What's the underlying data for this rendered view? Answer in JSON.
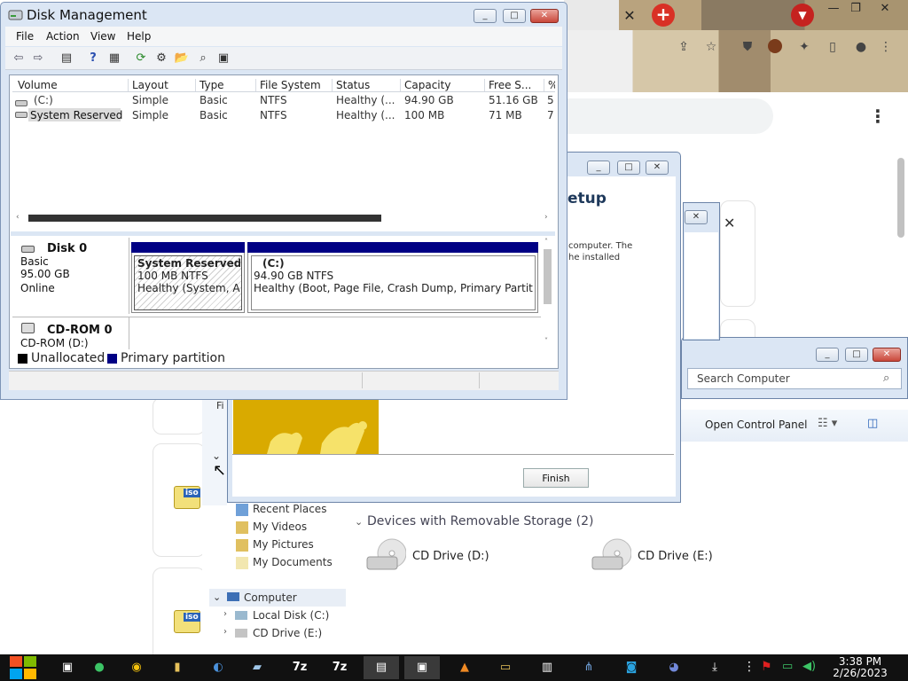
{
  "disk_management": {
    "title": "Disk Management",
    "menu": [
      "File",
      "Action",
      "View",
      "Help"
    ],
    "columns": [
      "Volume",
      "Layout",
      "Type",
      "File System",
      "Status",
      "Capacity",
      "Free S...",
      "%"
    ],
    "volumes": [
      {
        "volume": "(C:)",
        "layout": "Simple",
        "type": "Basic",
        "fs": "NTFS",
        "status": "Healthy (...",
        "capacity": "94.90 GB",
        "free": "51.16 GB",
        "pct": "5"
      },
      {
        "volume": "System Reserved",
        "layout": "Simple",
        "type": "Basic",
        "fs": "NTFS",
        "status": "Healthy (...",
        "capacity": "100 MB",
        "free": "71 MB",
        "pct": "7"
      }
    ],
    "disk0": {
      "name": "Disk 0",
      "type": "Basic",
      "size": "95.00 GB",
      "state": "Online"
    },
    "partitions": {
      "system_reserved": {
        "name": "System Reserved",
        "size": "100 MB NTFS",
        "status": "Healthy (System, Acti"
      },
      "c": {
        "name": "(C:)",
        "size": "94.90 GB NTFS",
        "status": "Healthy (Boot, Page File, Crash Dump, Primary Partition)"
      }
    },
    "cdrom": {
      "name": "CD-ROM 0",
      "drive": "CD-ROM (D:)"
    },
    "legend": {
      "unallocated": "Unallocated",
      "primary": "Primary partition",
      "unallocated_color": "#000000",
      "primary_color": "#000084"
    }
  },
  "setup_dialog": {
    "title_fragment": "etup",
    "text_line1": "computer. The",
    "text_line2": "he installed",
    "finish_label": "Finish"
  },
  "explorer": {
    "search_placeholder": "Search Computer",
    "open_control_panel": "Open Control Panel",
    "menu_fragment": "Fi",
    "nav": {
      "recent_places": "Recent Places",
      "my_videos": "My Videos",
      "my_pictures": "My Pictures",
      "my_documents": "My Documents",
      "computer": "Computer",
      "local_disk": "Local Disk (C:)",
      "cd_drive_e": "CD Drive (E:)"
    },
    "devices_heading": "Devices with Removable Storage (2)",
    "devices": [
      "CD Drive (D:)",
      "CD Drive (E:)"
    ]
  },
  "chrome": {
    "tab_close": "✕",
    "new_tab": "+",
    "close": "✕"
  },
  "iso_label": "iso",
  "taskbar": {
    "time": "3:38 PM",
    "date": "2/26/2023",
    "app_7z": "7z"
  }
}
